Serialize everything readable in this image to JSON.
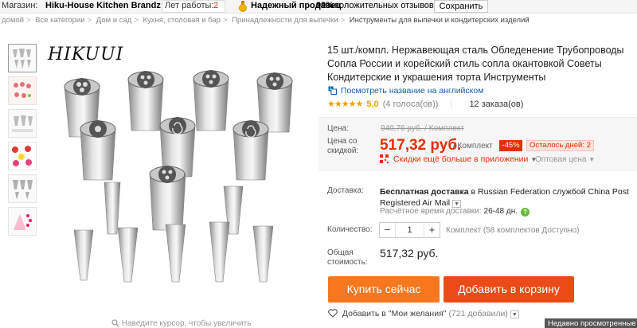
{
  "store_bar": {
    "store_label": "Магазин:",
    "store_name": "Hiku-House Kitchen Brandz store",
    "work_label": "Лет работы:",
    "work_years": "2",
    "seller_label": "Надежный продавец",
    "positive_pct": "99%",
    "positive_label": "положительных отзывов",
    "save_label": "Сохранить"
  },
  "breadcrumb": [
    "домой",
    "Все категории",
    "Дом и сад",
    "Кухня, столовая и бар",
    "Принадлежности для выпечки",
    "Инструменты для выпечки и кондитерских изделий"
  ],
  "gallery": {
    "brand_watermark": "HIKUUI",
    "zoom_hint": "Наведите курсор, чтобы увеличить"
  },
  "product": {
    "title": "15 шт./компл. Нержавеющая сталь Обледенение Трубопроводы Сопла России и корейский стиль сопла окантовкой Советы Кондитерские и украшения торта Инструменты",
    "translate_link": "Посмотреть название на английском",
    "stars": "★★★★★",
    "rating": "5.0",
    "votes": "(4 голоса(ов))",
    "orders": "12 заказа(ов)"
  },
  "price": {
    "label": "Цена:",
    "old": "940,76 руб. / Комплект",
    "discount_label": "Цена со скидкой:",
    "current": "517,32 руб.",
    "per_set": "/ Комплект",
    "discount_pct": "-45%",
    "days_left": "Осталось дней: 2",
    "app_discount": "Скидки ещё больше в приложении",
    "wholesale": "Оптовая цена"
  },
  "shipping": {
    "label": "Доставка:",
    "free_text": "Бесплатная доставка",
    "route": " в Russian Federation службой China Post Registered Air Mail",
    "delivery_label": "Расчётное время доставки:",
    "delivery_days": "26-48 дн."
  },
  "quantity": {
    "label": "Количество:",
    "value": "1",
    "stock": "Комплект (58 комплектов Доступно)"
  },
  "total": {
    "label": "Общая стоимость:",
    "value": "517,32 руб."
  },
  "actions": {
    "buy_now": "Купить сейчас",
    "add_to_cart": "Добавить в корзину",
    "wishlist": "Добавить в \"Мои желания\"",
    "wishlist_count": "(721 добавили)"
  },
  "recently_viewed": "Недавно просмотренные",
  "colors": {
    "accent_red": "#e62e04",
    "buy_orange": "#f7771e",
    "cart_red": "#ea4b17",
    "star": "#f4a000"
  }
}
